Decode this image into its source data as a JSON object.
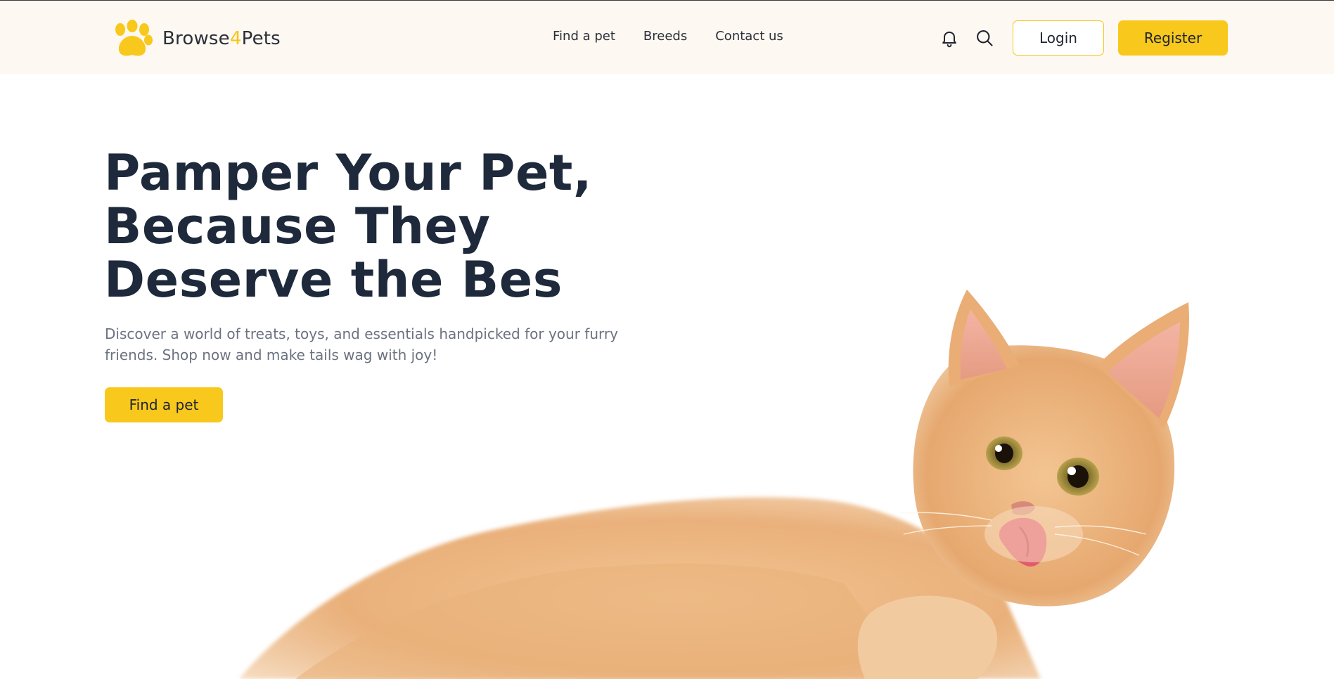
{
  "header": {
    "logo": {
      "text_main": "Browse",
      "text_accent": "4",
      "text_end": "Pets",
      "icon": "paw-icon"
    },
    "nav": [
      {
        "label": "Find a pet"
      },
      {
        "label": "Breeds"
      },
      {
        "label": "Contact us"
      }
    ],
    "icons": [
      "bell-icon",
      "search-icon"
    ],
    "login_label": "Login",
    "register_label": "Register"
  },
  "hero": {
    "title": "Pamper Your Pet, Because They Deserve the Bes",
    "subtitle": "Discover a world of treats, toys, and essentials handpicked for your furry friends. Shop now and make tails wag with joy!",
    "cta_label": "Find a pet",
    "image": "orange-kitten-licking-lips"
  },
  "colors": {
    "accent": "#f8c81c",
    "header_bg": "#fdf8f1",
    "title": "#1e2a3b",
    "subtitle": "#6b7280"
  }
}
